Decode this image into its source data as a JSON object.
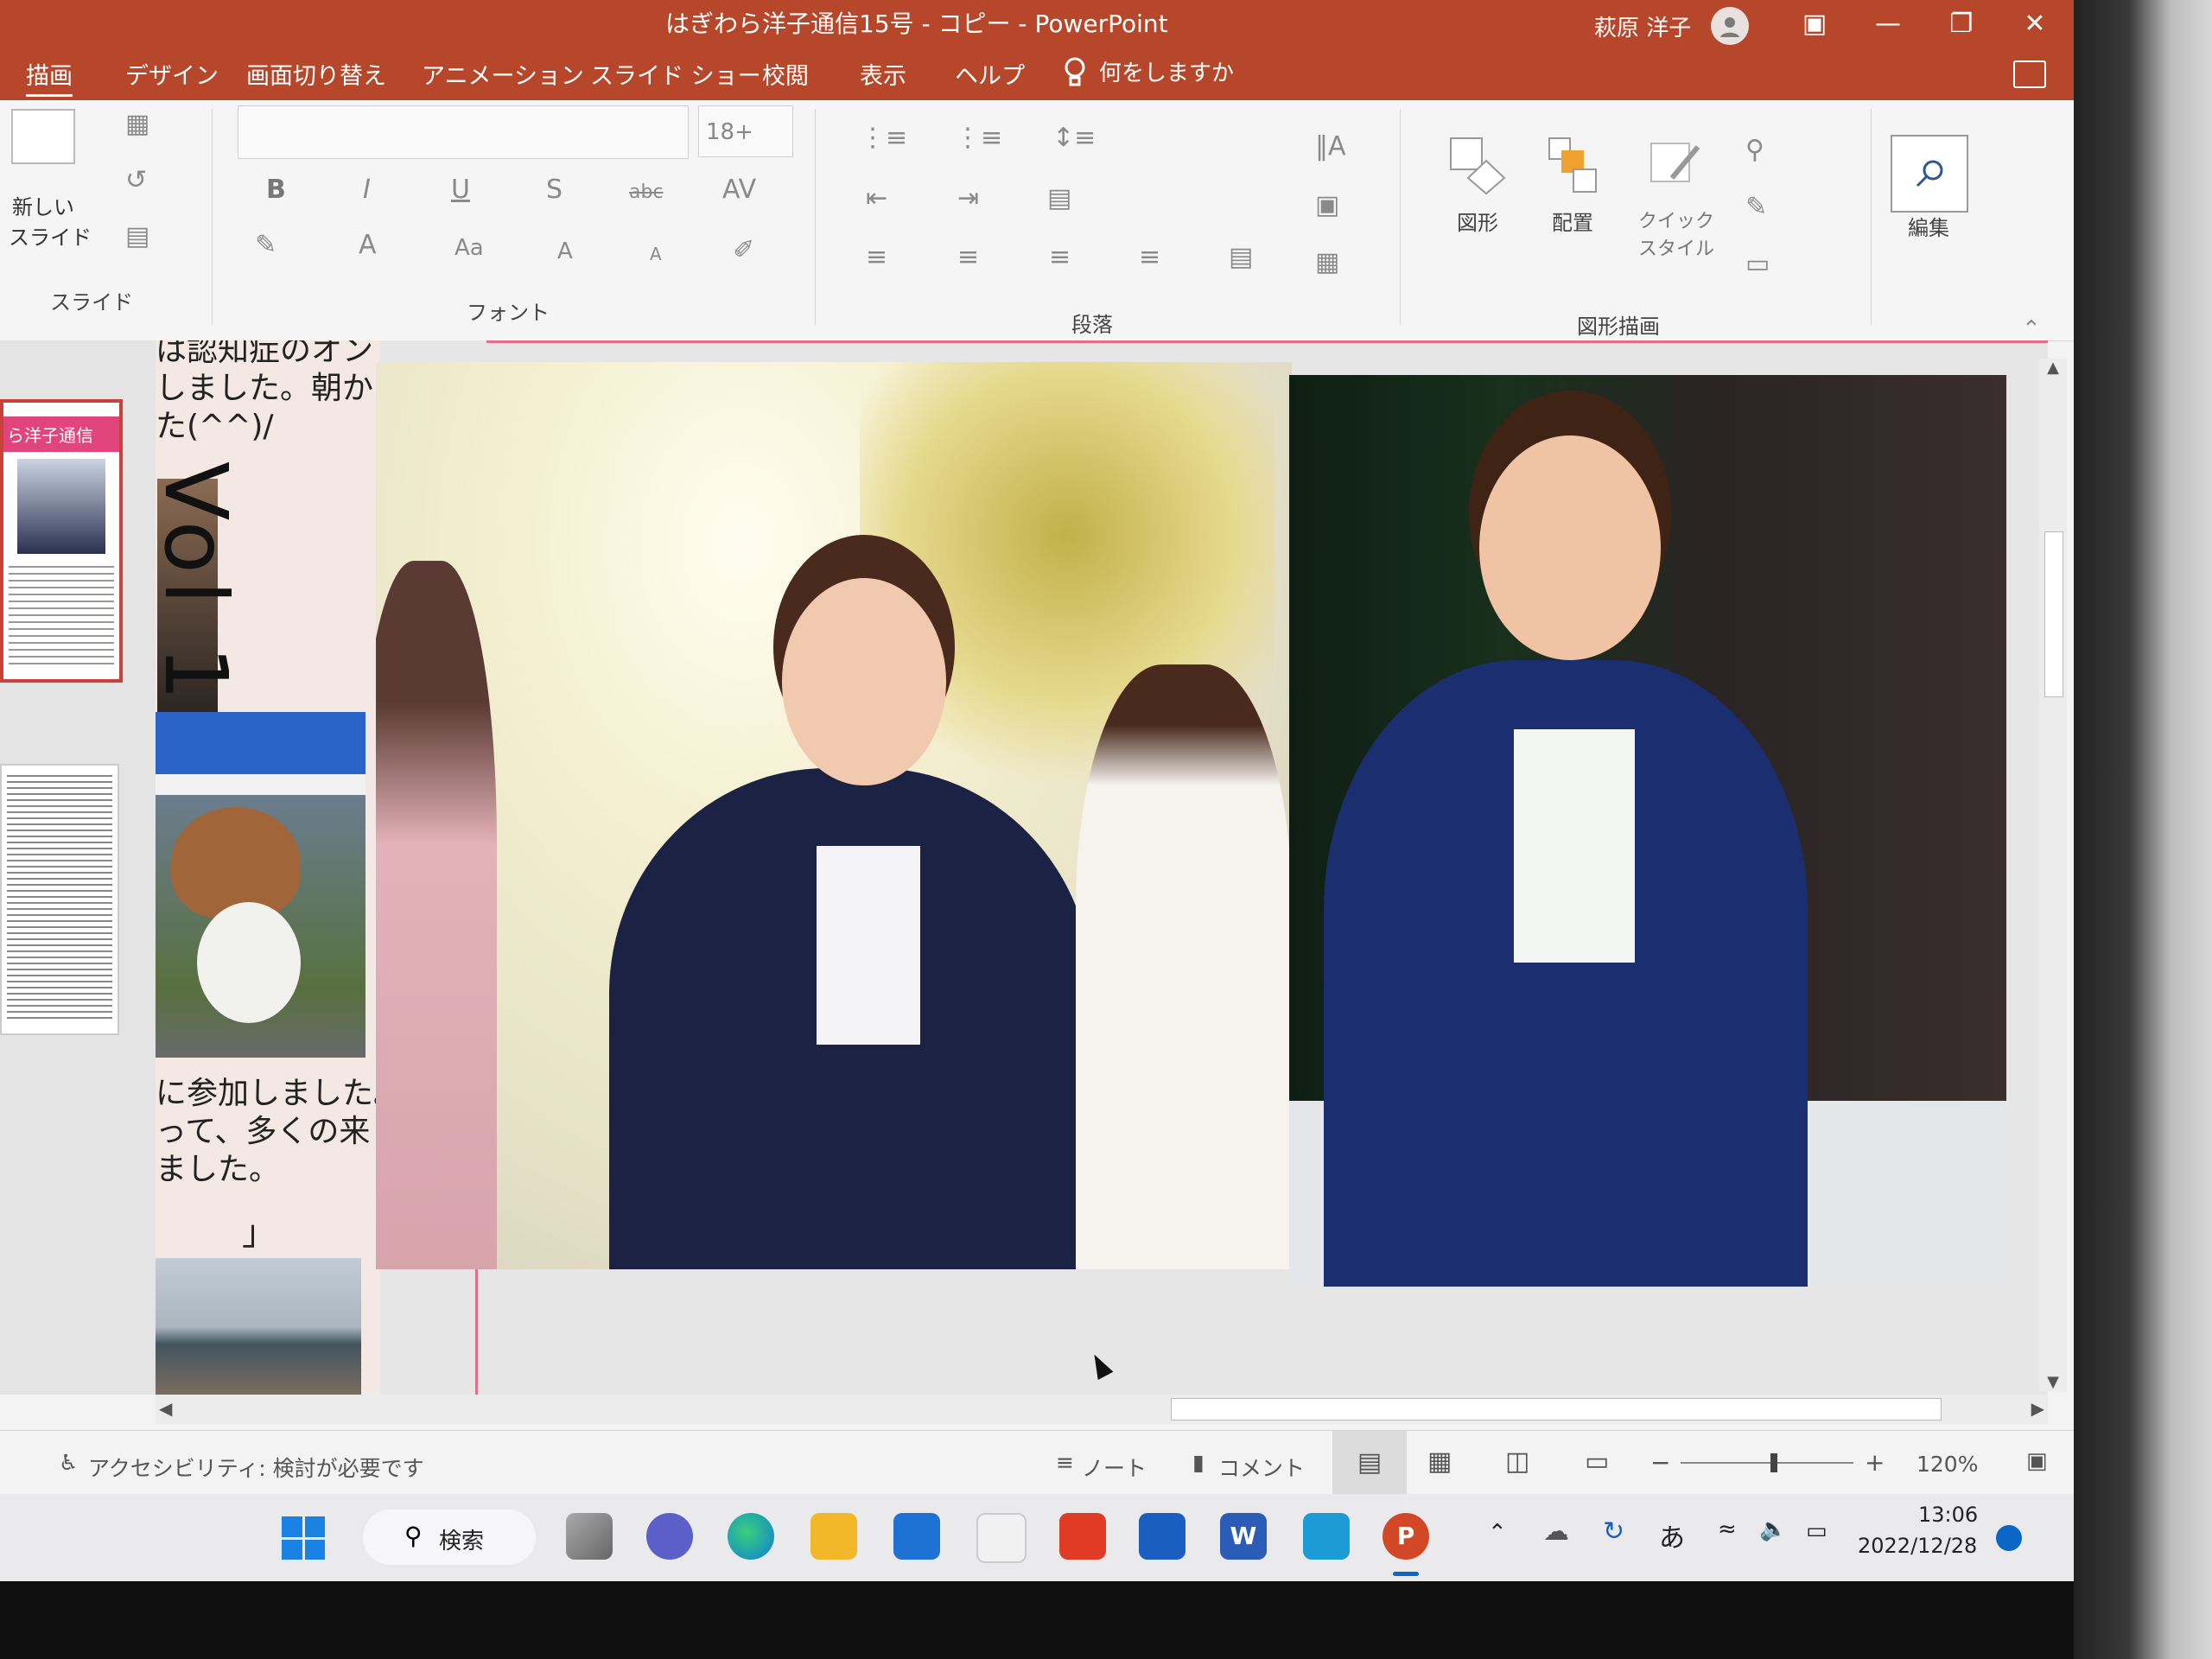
{
  "window": {
    "title": "はぎわら洋子通信15号 - コピー  -  PowerPoint",
    "user_name": "萩原 洋子"
  },
  "tabs": [
    "描画",
    "デザイン",
    "画面切り替え",
    "アニメーション",
    "スライド ショー",
    "校閲",
    "表示",
    "ヘルプ"
  ],
  "tell_me": "何をしますか",
  "ribbon": {
    "slides_group": {
      "label": "スライド",
      "new_slide": "新しい\nスライド"
    },
    "font_group": {
      "label": "フォント",
      "font_name": "",
      "font_size": "18+",
      "bold": "B",
      "italic": "I",
      "underline": "U",
      "shadow": "S",
      "strike": "abc",
      "spacing": "AV",
      "font_color": "A",
      "change_case": "Aa",
      "grow": "A",
      "shrink": "A"
    },
    "paragraph_group": {
      "label": "段落"
    },
    "drawing_group": {
      "label": "図形描画",
      "shapes": "図形",
      "arrange": "配置",
      "quick_styles": "クイック\nスタイル"
    },
    "editing": {
      "label": "編集"
    }
  },
  "slide": {
    "text_top": "は認知症のオン\nしました。朝から\nた(^^)/",
    "vol_text": "Vol 1",
    "text_bottom": "に参加しました。\nって、多くの来\nました。",
    "quote_mark": "」",
    "thumb1_title": "ら洋子通信"
  },
  "status_bar": {
    "accessibility": "アクセシビリティ: 検討が必要です",
    "notes": "ノート",
    "comments": "コメント",
    "zoom": "120%"
  },
  "taskbar": {
    "search": "検索",
    "ime": "あ",
    "time": "13:06",
    "date": "2022/12/28"
  },
  "colors": {
    "accent": "#b7472a",
    "pink": "#e86b8a"
  }
}
